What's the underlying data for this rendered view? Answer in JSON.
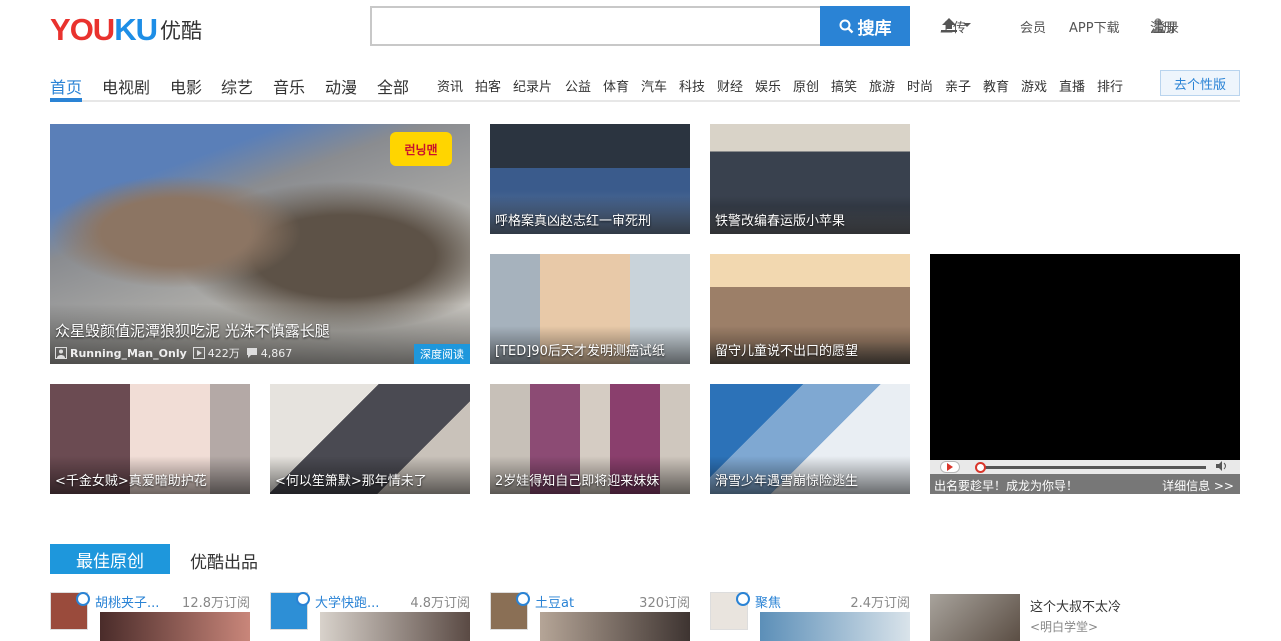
{
  "header": {
    "logo_en_y": "Y",
    "logo_en_ou": "OU",
    "logo_en_ku": "KU",
    "logo_cn": "优酷",
    "search_value": "",
    "search_button": "搜库",
    "upload": "上传",
    "member": "会员",
    "app": "APP下载",
    "login": "登录",
    "divider": "|",
    "register": "注册"
  },
  "nav": {
    "main": [
      "首页",
      "电视剧",
      "电影",
      "综艺",
      "音乐",
      "动漫",
      "全部"
    ],
    "sub": [
      "资讯",
      "拍客",
      "纪录片",
      "公益",
      "体育",
      "汽车",
      "科技",
      "财经",
      "娱乐",
      "原创",
      "搞笑",
      "旅游",
      "时尚",
      "亲子",
      "教育",
      "游戏",
      "直播",
      "排行"
    ],
    "personalize": "去个性版"
  },
  "featured": {
    "title": "众星毁颜值泥潭狼狈吃泥 光洙不慎露长腿",
    "channel": "Running_Man_Only",
    "plays": "422万",
    "comments": "4,867",
    "deep_read": "深度阅读",
    "logo_text": "런닝맨"
  },
  "tiles": [
    "呼格案真凶赵志红一审死刑",
    "铁警改编春运版小苹果",
    "[TED]90后天才发明测癌试纸",
    "留守儿童说不出口的愿望",
    "<千金女贼>真爱暗助护花",
    "<何以笙箫默>那年情未了",
    "2岁娃得知自己即将迎来妹妹",
    "滑雪少年遇雪崩惊险逃生"
  ],
  "ad": {
    "left": "出名要趁早！成龙为你导！",
    "right": "详细信息 >>",
    "progress": 0.0
  },
  "section": {
    "tab_active": "最佳原创",
    "tab_other": "优酷出品"
  },
  "channels": [
    {
      "name": "胡桃夹子...",
      "subs": "12.8万订阅"
    },
    {
      "name": "大学快跑...",
      "subs": "4.8万订阅"
    },
    {
      "name": "土豆at",
      "subs": "320订阅"
    },
    {
      "name": "聚焦",
      "subs": "2.4万订阅"
    }
  ],
  "recommend": {
    "title": "这个大叔不太冷",
    "sub": "<明白学堂>"
  },
  "colors": {
    "accent": "#2a83d5",
    "brand_red": "#e9322e",
    "tag_blue": "#1e97dc"
  }
}
